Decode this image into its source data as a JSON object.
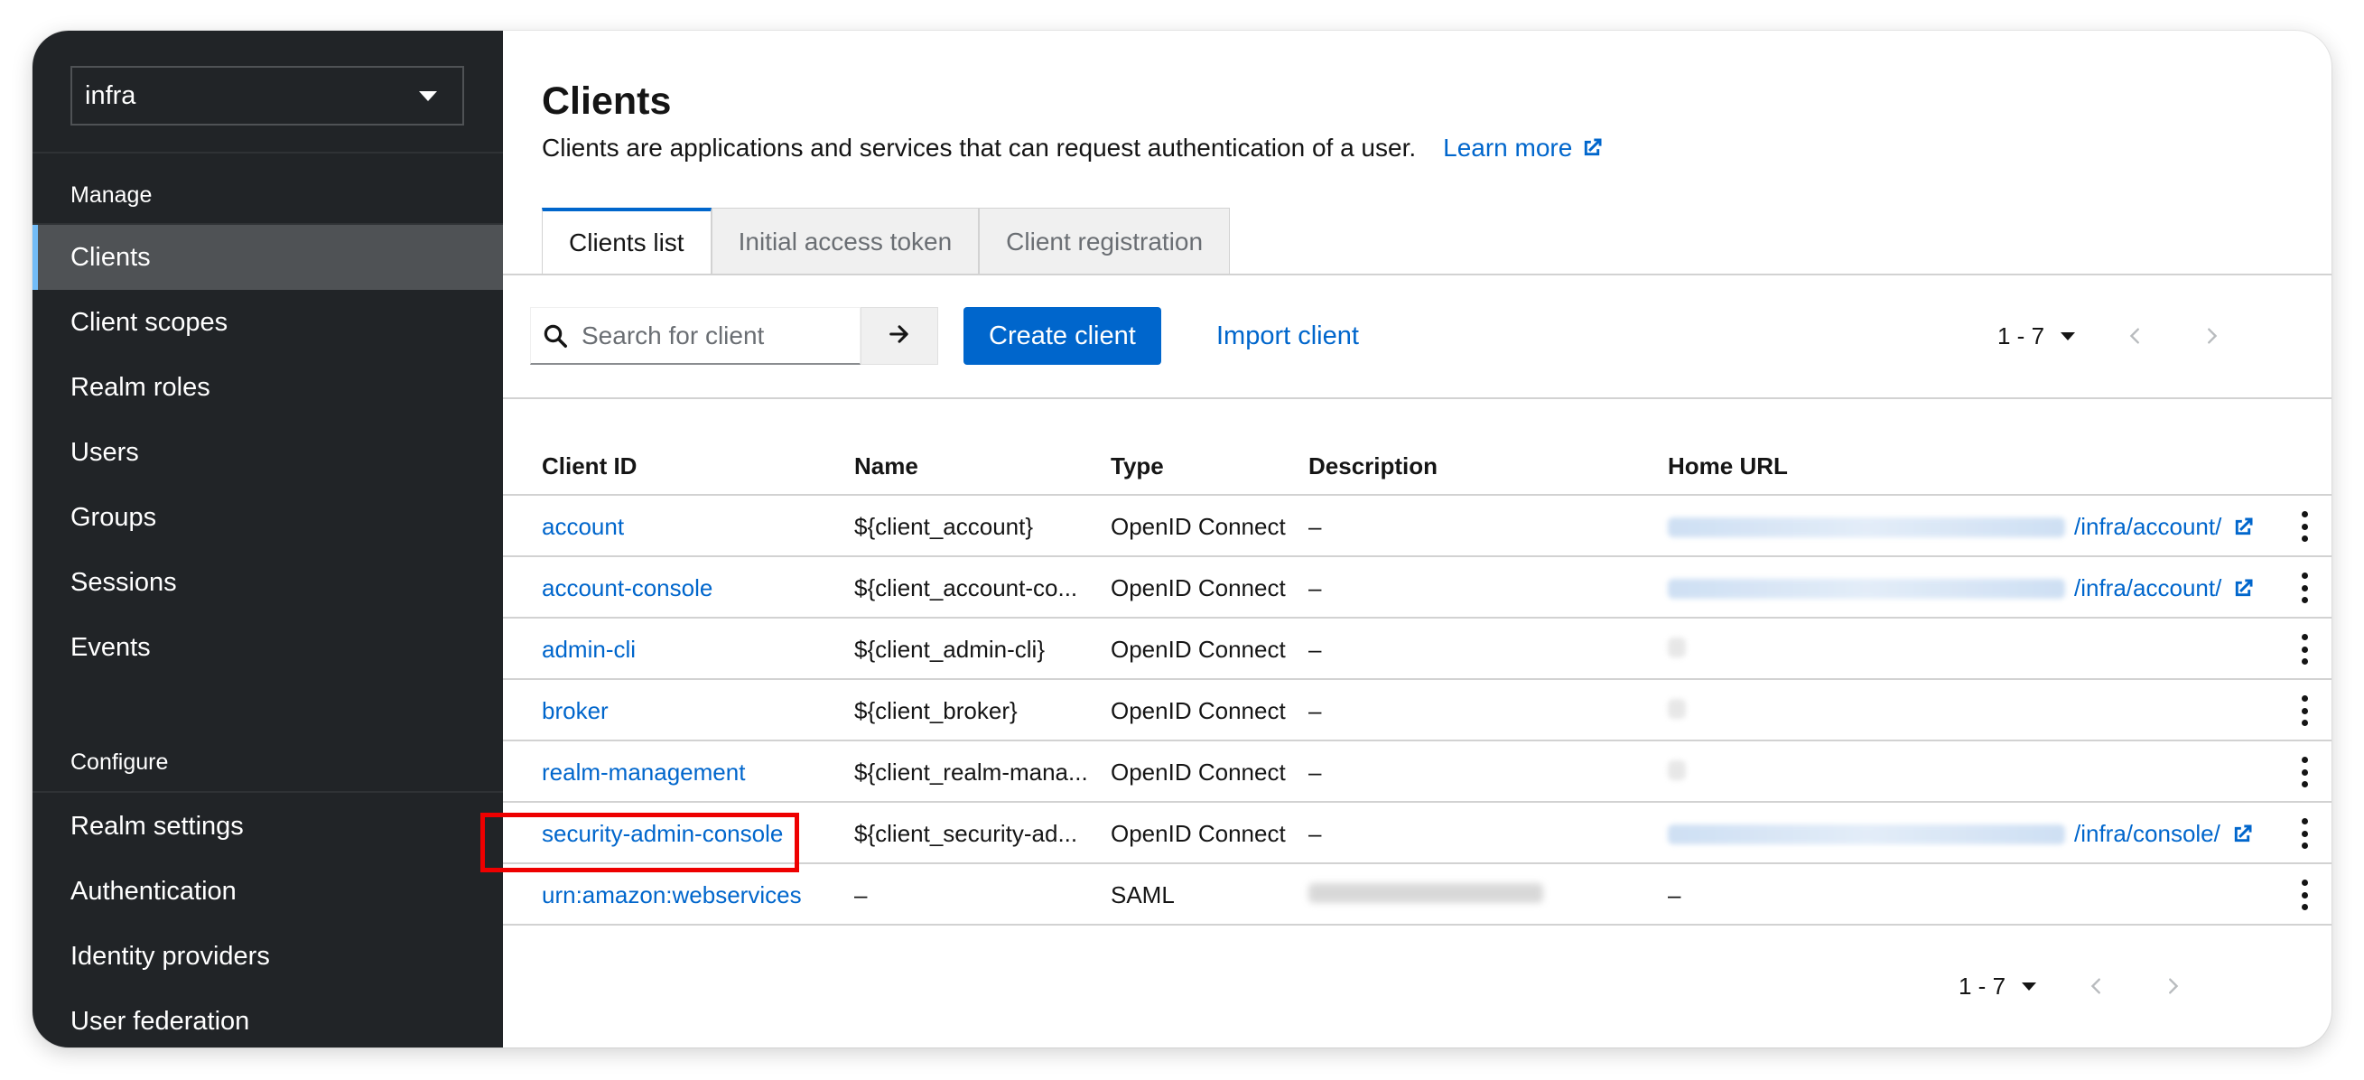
{
  "realm_selector": {
    "value": "infra"
  },
  "sidebar": {
    "manage_heading": "Manage",
    "manage_items": [
      {
        "label": "Clients",
        "active": true
      },
      {
        "label": "Client scopes"
      },
      {
        "label": "Realm roles"
      },
      {
        "label": "Users"
      },
      {
        "label": "Groups"
      },
      {
        "label": "Sessions"
      },
      {
        "label": "Events"
      }
    ],
    "configure_heading": "Configure",
    "configure_items": [
      {
        "label": "Realm settings"
      },
      {
        "label": "Authentication"
      },
      {
        "label": "Identity providers"
      },
      {
        "label": "User federation"
      }
    ]
  },
  "page": {
    "title": "Clients",
    "description": "Clients are applications and services that can request authentication of a user.",
    "learn_more": "Learn more"
  },
  "tabs": [
    {
      "label": "Clients list",
      "active": true
    },
    {
      "label": "Initial access token"
    },
    {
      "label": "Client registration"
    }
  ],
  "toolbar": {
    "search_placeholder": "Search for client",
    "create_label": "Create client",
    "import_label": "Import client"
  },
  "pagination": {
    "range": "1 - 7"
  },
  "table": {
    "columns": [
      "Client ID",
      "Name",
      "Type",
      "Description",
      "Home URL"
    ],
    "rows": [
      {
        "client_id": "account",
        "name": "${client_account}",
        "type": "OpenID Connect",
        "description": "–",
        "home_url_suffix": "/infra/account/",
        "home_url_blurred": true
      },
      {
        "client_id": "account-console",
        "name": "${client_account-co...",
        "type": "OpenID Connect",
        "description": "–",
        "home_url_suffix": "/infra/account/",
        "home_url_blurred": true
      },
      {
        "client_id": "admin-cli",
        "name": "${client_admin-cli}",
        "type": "OpenID Connect",
        "description": "–",
        "home_url_suffix": "",
        "home_url_blurred": true
      },
      {
        "client_id": "broker",
        "name": "${client_broker}",
        "type": "OpenID Connect",
        "description": "–",
        "home_url_suffix": "",
        "home_url_blurred": true
      },
      {
        "client_id": "realm-management",
        "name": "${client_realm-mana...",
        "type": "OpenID Connect",
        "description": "–",
        "home_url_suffix": "",
        "home_url_blurred": true
      },
      {
        "client_id": "security-admin-console",
        "name": "${client_security-ad...",
        "type": "OpenID Connect",
        "description": "–",
        "home_url_suffix": "/infra/console/",
        "home_url_blurred": true
      },
      {
        "client_id": "urn:amazon:webservices",
        "name": "–",
        "type": "SAML",
        "description": "",
        "description_blurred": true,
        "home_url_suffix": "–",
        "home_url_blurred": false
      }
    ]
  },
  "colors": {
    "accent": "#0066cc",
    "sidebar_bg": "#212427",
    "highlight": "#ee0000"
  },
  "icons": {
    "search": "search-icon",
    "go": "arrow-right-icon",
    "external": "external-link-icon",
    "kebab": "kebab-menu-icon"
  }
}
